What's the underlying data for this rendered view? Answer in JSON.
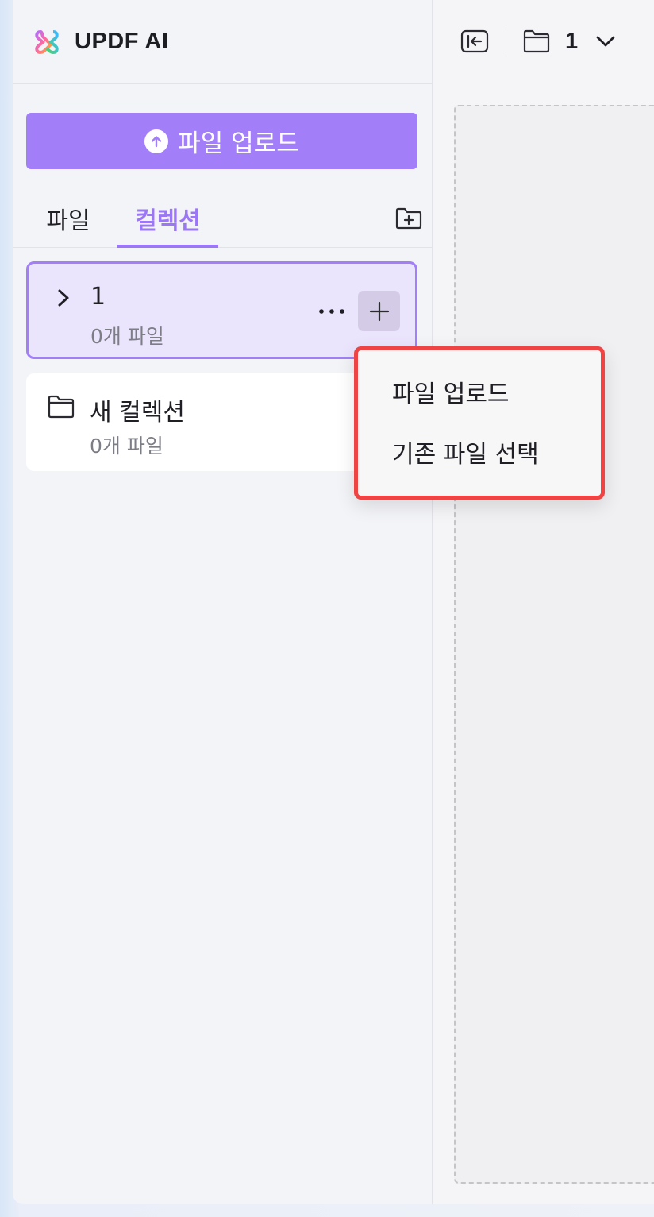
{
  "app": {
    "title": "UPDF AI"
  },
  "sidebar": {
    "upload_button": "파일 업로드",
    "tabs": [
      {
        "label": "파일",
        "active": false
      },
      {
        "label": "컬렉션",
        "active": true
      }
    ],
    "collections": [
      {
        "name": "1",
        "count": "0개 파일",
        "selected": true
      },
      {
        "name": "새 컬렉션",
        "count": "0개 파일",
        "selected": false
      }
    ]
  },
  "header": {
    "current_collection": "1"
  },
  "menu": {
    "items": [
      {
        "label": "파일 업로드"
      },
      {
        "label": "기존 파일 선택"
      }
    ]
  },
  "colors": {
    "accent": "#a27ff9",
    "selected_bg": "#ebe4fd",
    "highlight": "#ef4444"
  }
}
